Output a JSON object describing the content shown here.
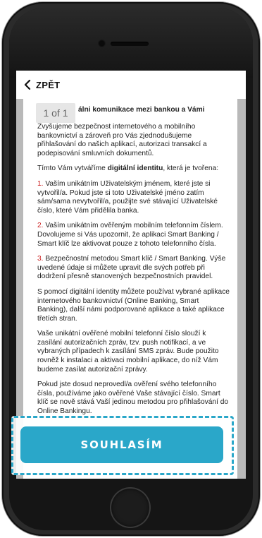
{
  "nav": {
    "back_label": "ZPĚT"
  },
  "document": {
    "page_counter": "1 of 1",
    "title": "álni komunikace mezi bankou a Vámi",
    "paragraphs": {
      "p1": "Zvyšujeme bezpečnost internetového a mobilního bankovnictví a zároveň pro Vás zjednodušujeme přihlašování do našich aplikací, autorizaci transakcí a podepisování smluvních dokumentů.",
      "p2_before": "Tímto Vám vytváříme ",
      "p2_bold": "digitální identitu",
      "p2_after": ", která je tvořena:",
      "item1_num": "1.",
      "item1_text": " Vaším unikátním Uživatelským jménem, které jste si vytvořil/a. Pokud jste si toto Uživatelské jméno zatím sám/sama nevytvořil/a, použijte své stávající Uživatelské číslo, které Vám přidělila banka.",
      "item2_num": "2.",
      "item2_text": " Vaším unikátním ověřeným mobilním telefonním číslem. Dovolujeme si Vás upozornit, že aplikaci Smart Banking / Smart klíč lze aktivovat pouze z tohoto telefonního čísla.",
      "item3_num": "3.",
      "item3_text": " Bezpečnostní metodou Smart klíč / Smart Banking. Výše uvedené údaje si můžete upravit dle svých potřeb při dodržení přesně stanovených bezpečnostních pravidel.",
      "p4": "S pomocí digitální identity můžete používat vybrané aplikace internetového bankovnictví (Online Banking, Smart Banking), další námi podporované aplikace a také aplikace třetích stran.",
      "p5": "Vaše unikátní ověřené mobilní telefonní číslo slouží k zasílání autorizačních zpráv, tzv. push notifikací, a ve vybraných případech k zasílání SMS zpráv. Bude použito rovněž k instalaci a aktivaci mobilní aplikace, do níž Vám budeme zasílat autorizační zprávy.",
      "p6": "Pokud jste dosud neprovedl/a ověření svého telefonního čísla, používáme jako ověřené Vaše stávající číslo. Smart klíč se nově stává Vaší jedinou metodou pro přihlašování do Online Bankingu."
    }
  },
  "cta": {
    "label": "SOUHLASÍM"
  },
  "icons": {
    "back": "chevron-left-icon"
  },
  "colors": {
    "accent": "#2aa7c9",
    "list_number": "#cc1f1f"
  }
}
